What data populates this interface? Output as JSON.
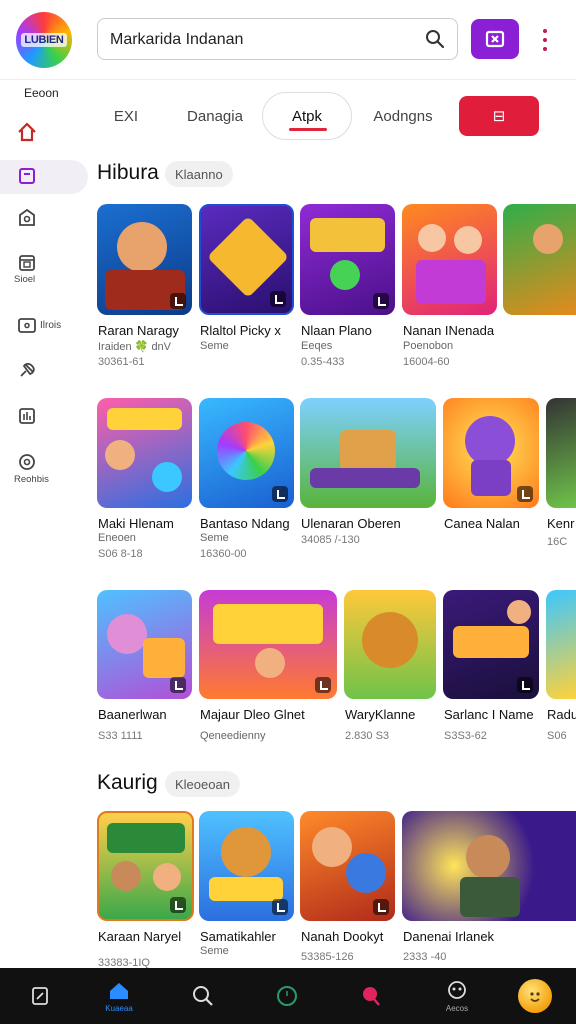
{
  "header": {
    "logo_text": "LUBIEN",
    "search_value": "Markarida Indanan",
    "icons": {
      "search": "search-icon",
      "action": "tag-icon",
      "more": "more-vertical-icon"
    },
    "accent": "#8a1fd6"
  },
  "sidebar": {
    "heading": "Eeoon",
    "items": [
      {
        "icon": "home-icon",
        "label": "",
        "active": false,
        "color": "#c62828"
      },
      {
        "icon": "library-icon",
        "label": "",
        "active": true,
        "color": "#8a1fd6"
      },
      {
        "icon": "store-icon",
        "label": "",
        "active": false
      },
      {
        "icon": "calendar-icon",
        "label": "Sioel",
        "active": false
      },
      {
        "icon": "tv-icon",
        "label": "Ilrois",
        "active": false
      },
      {
        "icon": "pin-icon",
        "label": "",
        "active": false
      },
      {
        "icon": "chart-icon",
        "label": "",
        "active": false
      },
      {
        "icon": "settings-icon",
        "label": "Reohbis",
        "active": false
      }
    ]
  },
  "tabs": [
    {
      "label": "EXI",
      "selected": false
    },
    {
      "label": "Danagia",
      "selected": false
    },
    {
      "label": "Atpk",
      "selected": true
    },
    {
      "label": "Aodngns",
      "selected": false
    },
    {
      "label": "⊟",
      "selected": false,
      "red": true
    }
  ],
  "sections": [
    {
      "title": "Hibura",
      "chip": "Klaanno",
      "rows": [
        [
          {
            "name": "Raran Naragy",
            "sub": "Iraiden 🍀 dnV",
            "meta": "30361-61"
          },
          {
            "name": "Rlaltol Picky x",
            "sub": "Seme",
            "meta": ""
          },
          {
            "name": "Nlaan Plano",
            "sub": "Eeqes",
            "meta": "0.35-433"
          },
          {
            "name": "Nanan INenada",
            "sub": "Poenobon",
            "meta": "16004-60"
          },
          {
            "name": "",
            "sub": "",
            "meta": ""
          }
        ],
        [
          {
            "name": "Maki Hlenam",
            "sub": "Eneoen",
            "meta": "S06 8-18"
          },
          {
            "name": "Bantaso Ndang",
            "sub": "Seme",
            "meta": "16360-00"
          },
          {
            "name": "Ulenaran Oberen",
            "sub": "",
            "meta": "34085 /-130"
          },
          {
            "name": "Canea Nalan",
            "sub": "",
            "meta": ""
          },
          {
            "name": "Kenr",
            "sub": "",
            "meta": "16C"
          }
        ],
        [
          {
            "name": "Baanerlwan",
            "sub": "",
            "meta": "S33 1111"
          },
          {
            "name": "Majaur Dleo Glnet",
            "sub": "Qeneedienny",
            "meta": ""
          },
          {
            "name": "WaryKlanne",
            "sub": "",
            "meta": "2.830 S3"
          },
          {
            "name": "Sarlanc I Name",
            "sub": "",
            "meta": "S3S3-62"
          },
          {
            "name": "Radu",
            "sub": "",
            "meta": "S06"
          }
        ]
      ]
    },
    {
      "title": "Kaurig",
      "chip": "Kleoeoan",
      "rows": [
        [
          {
            "name": "Karaan Naryel",
            "sub": "",
            "meta": "33383-1IQ"
          },
          {
            "name": "Samatikahler",
            "sub": "Seme",
            "meta": ""
          },
          {
            "name": "Nanah Dookyt",
            "sub": "",
            "meta": "53385-126"
          },
          {
            "name": "Danenai Irlanek",
            "sub": "",
            "meta": "2333 -40"
          }
        ]
      ]
    }
  ],
  "bottom_nav": [
    {
      "icon": "note-icon",
      "label": ""
    },
    {
      "icon": "home-icon",
      "label": "Kuaeaa",
      "active": true
    },
    {
      "icon": "search-icon",
      "label": ""
    },
    {
      "icon": "circle-icon",
      "label": ""
    },
    {
      "icon": "heart-icon",
      "label": ""
    },
    {
      "icon": "alien-icon",
      "label": "Aecos"
    },
    {
      "icon": "avatar-icon",
      "label": ""
    }
  ]
}
